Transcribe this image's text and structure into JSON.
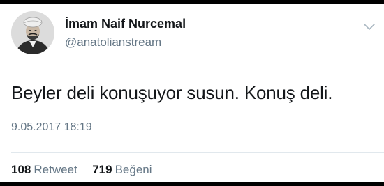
{
  "tweet": {
    "display_name": "İmam Naif Nurcemal",
    "handle": "@anatolianstream",
    "text": "Beyler deli konuşuyor susun. Konuş deli.",
    "timestamp": "9.05.2017 18:19",
    "retweet_count": "108",
    "retweet_label": "Retweet",
    "like_count": "719",
    "like_label": "Beğeni"
  },
  "icons": {
    "menu": "chevron-down-icon",
    "avatar": "avatar"
  },
  "colors": {
    "text_primary": "#14171a",
    "text_secondary": "#657786",
    "divider": "#e1e8ed"
  }
}
